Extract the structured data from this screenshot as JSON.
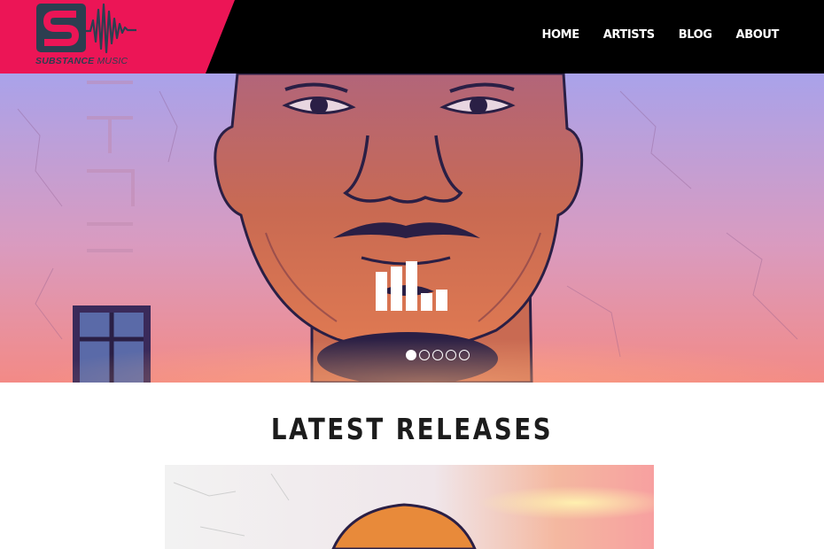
{
  "brand": {
    "name_bold": "SUBSTANCE",
    "name_light": "MUSIC",
    "logo_icon": "s-badge-waveform-icon",
    "accent_color": "#ec1556",
    "logo_ink_color": "#2c3e50"
  },
  "nav": {
    "items": [
      {
        "label": "HOME"
      },
      {
        "label": "ARTISTS"
      },
      {
        "label": "BLOG"
      },
      {
        "label": "ABOUT"
      }
    ],
    "background_color": "#000000",
    "text_color": "#ffffff"
  },
  "hero": {
    "artwork": "illustrated-portrait-artwork",
    "loader_icon": "equalizer-bars-icon",
    "slides": [
      {
        "active": true
      },
      {
        "active": false
      },
      {
        "active": false
      },
      {
        "active": false
      },
      {
        "active": false
      }
    ],
    "colors": {
      "sky_top": "#a9a2ea",
      "sky_bottom": "#f38a86",
      "skin": "#c96a52"
    }
  },
  "latest": {
    "title": "LATEST RELEASES",
    "card_artwork": "release-cover-artwork"
  }
}
